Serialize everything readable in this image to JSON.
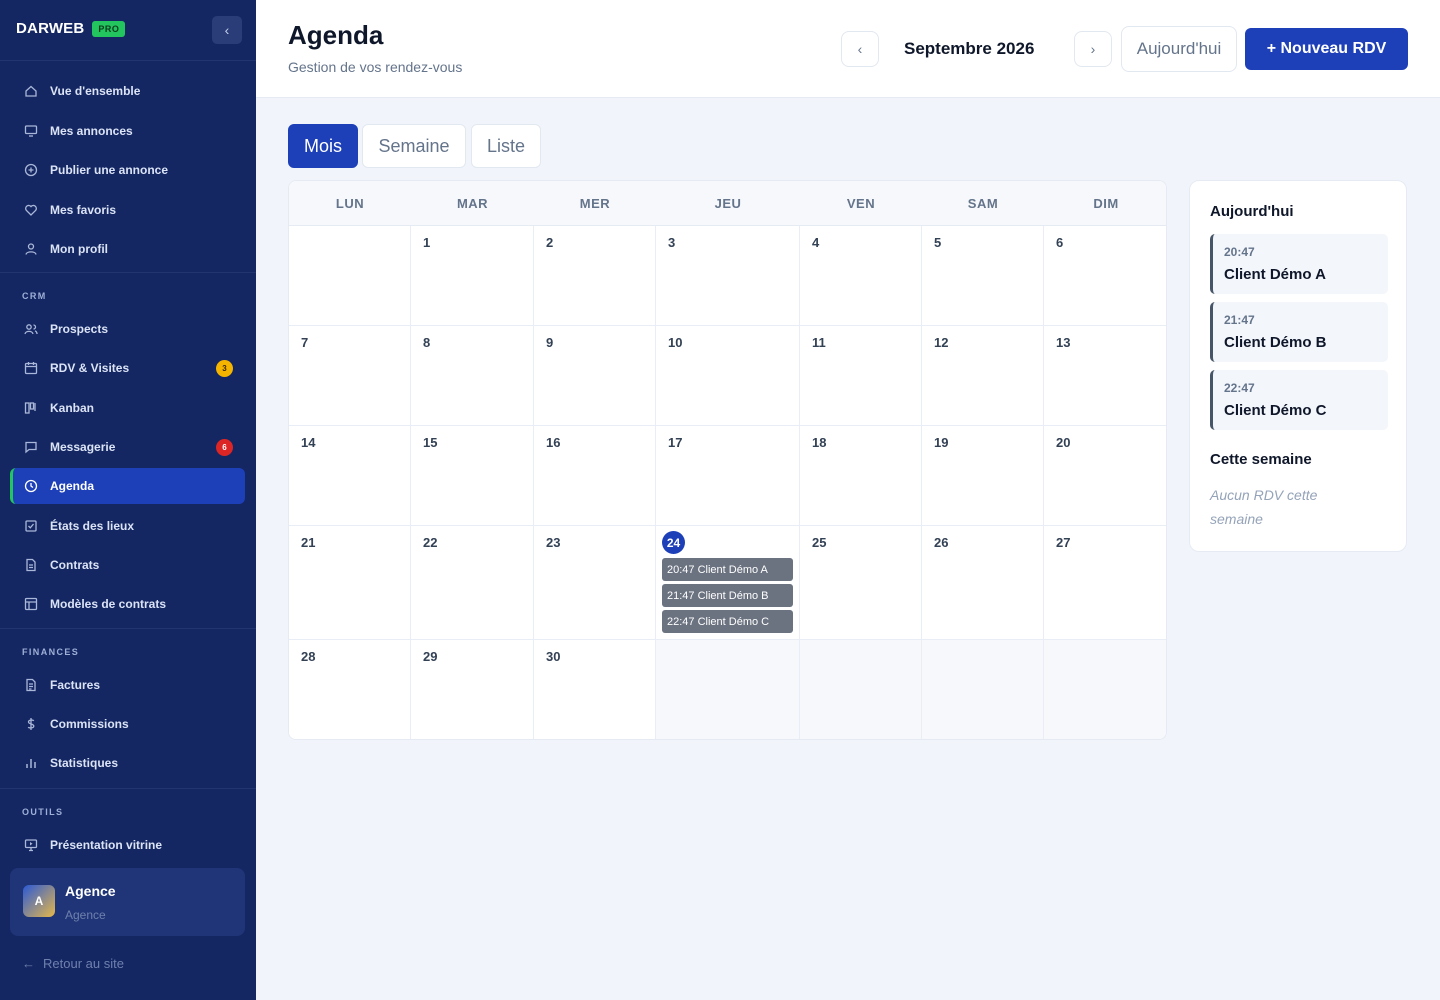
{
  "sidebar": {
    "brand": "DARWEB",
    "pro": "PRO",
    "collapse_icon": "chevron-left-icon",
    "items_top": [
      {
        "label": "Vue d'ensemble",
        "icon": "home-icon"
      },
      {
        "label": "Mes annonces",
        "icon": "monitor-icon"
      },
      {
        "label": "Publier une annonce",
        "icon": "plus-circle-icon"
      },
      {
        "label": "Mes favoris",
        "icon": "heart-icon"
      },
      {
        "label": "Mon profil",
        "icon": "user-icon"
      }
    ],
    "section_crm": "CRM",
    "items_crm": [
      {
        "label": "Prospects",
        "icon": "users-icon"
      },
      {
        "label": "RDV & Visites",
        "icon": "calendar-icon",
        "badge": "3"
      },
      {
        "label": "Kanban",
        "icon": "kanban-icon"
      },
      {
        "label": "Messagerie",
        "icon": "message-icon",
        "badge": "6"
      },
      {
        "label": "Agenda",
        "icon": "clock-icon",
        "active": true
      },
      {
        "label": "États des lieux",
        "icon": "checklist-icon"
      },
      {
        "label": "Contrats",
        "icon": "document-icon"
      },
      {
        "label": "Modèles de contrats",
        "icon": "template-icon"
      }
    ],
    "section_finances": "FINANCES",
    "items_finances": [
      {
        "label": "Factures",
        "icon": "invoice-icon"
      },
      {
        "label": "Commissions",
        "icon": "dollar-icon"
      },
      {
        "label": "Statistiques",
        "icon": "bar-chart-icon"
      }
    ],
    "section_outils": "OUTILS",
    "items_outils": [
      {
        "label": "Présentation vitrine",
        "icon": "presentation-icon"
      }
    ],
    "user": {
      "initial": "A",
      "name": "Agence",
      "role": "Agence"
    },
    "back_link": "Retour au site"
  },
  "header": {
    "title": "Agenda",
    "subtitle": "Gestion de vos rendez-vous",
    "month": "Septembre 2026",
    "prev": "‹",
    "next": "›",
    "today_button": "Aujourd'hui",
    "new_button": "+ Nouveau RDV"
  },
  "view_tabs": [
    {
      "label": "Mois",
      "active": true
    },
    {
      "label": "Semaine",
      "active": false
    },
    {
      "label": "Liste",
      "active": false
    }
  ],
  "calendar": {
    "weekdays": [
      "LUN",
      "MAR",
      "MER",
      "JEU",
      "VEN",
      "SAM",
      "DIM"
    ],
    "weeks": [
      [
        "",
        "1",
        "2",
        "3",
        "4",
        "5",
        "6"
      ],
      [
        "7",
        "8",
        "9",
        "10",
        "11",
        "12",
        "13"
      ],
      [
        "14",
        "15",
        "16",
        "17",
        "18",
        "19",
        "20"
      ],
      [
        "21",
        "22",
        "23",
        "24",
        "25",
        "26",
        "27"
      ],
      [
        "28",
        "29",
        "30",
        "",
        "",
        "",
        ""
      ]
    ],
    "today": "24",
    "events": [
      "20:47 Client Démo A",
      "21:47 Client Démo B",
      "22:47 Client Démo C"
    ]
  },
  "panel": {
    "today_title": "Aujourd'hui",
    "today_items": [
      {
        "time": "20:47",
        "name": "Client Démo A"
      },
      {
        "time": "21:47",
        "name": "Client Démo B"
      },
      {
        "time": "22:47",
        "name": "Client Démo C"
      }
    ],
    "week_title": "Cette semaine",
    "week_empty": "Aucun RDV cette semaine"
  }
}
